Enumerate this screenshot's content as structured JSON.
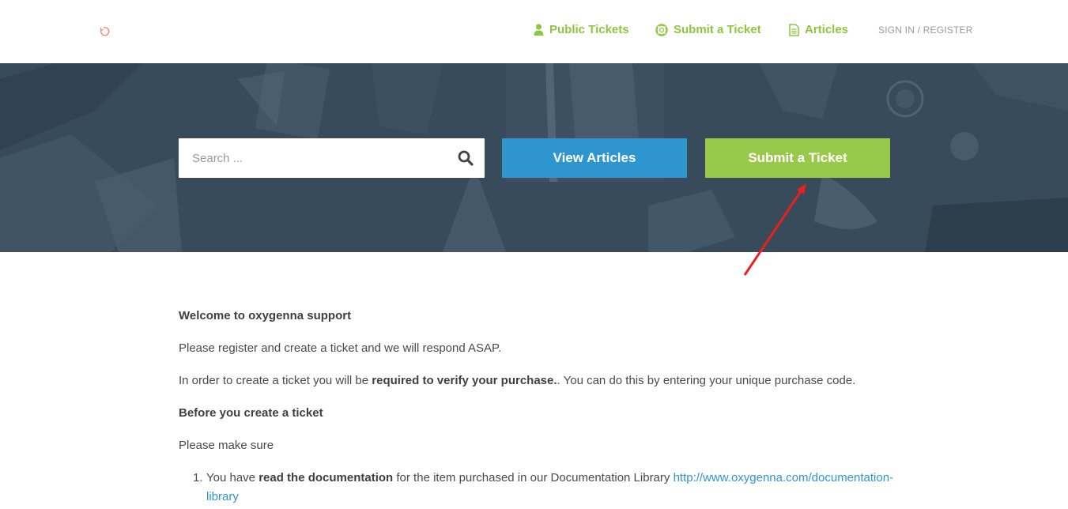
{
  "header": {
    "logo_icon": "spinner-icon",
    "nav": [
      {
        "label": "Public Tickets",
        "icon": "user-icon"
      },
      {
        "label": "Submit a Ticket",
        "icon": "lifebuoy-icon"
      },
      {
        "label": "Articles",
        "icon": "document-icon"
      }
    ],
    "signin_label": "SIGN IN / REGISTER"
  },
  "hero": {
    "search_placeholder": "Search ...",
    "view_articles_label": "View Articles",
    "submit_ticket_label": "Submit a Ticket"
  },
  "colors": {
    "accent_green": "#8dc63f",
    "button_green": "#99c94b",
    "button_blue": "#2e95cf",
    "hero_bg": "#3a4d5c",
    "annotation_arrow": "#e8201e"
  },
  "content": {
    "welcome": "Welcome to oxygenna support",
    "register_line": "Please register and create a ticket and we will respond ASAP.",
    "order_prefix": "In order to create a ticket you will be ",
    "order_bold": "required to verify your purchase.",
    "order_suffix": ". You can do this by entering your unique purchase code.",
    "before_heading": "Before you create a ticket",
    "make_sure": "Please make sure",
    "list": [
      {
        "number": "1.",
        "prefix": "You have ",
        "bold": "read the documentation",
        "middle": " for the item purchased in our Documentation Library ",
        "link": "http://www.oxygenna.com/documentation-library"
      }
    ]
  }
}
